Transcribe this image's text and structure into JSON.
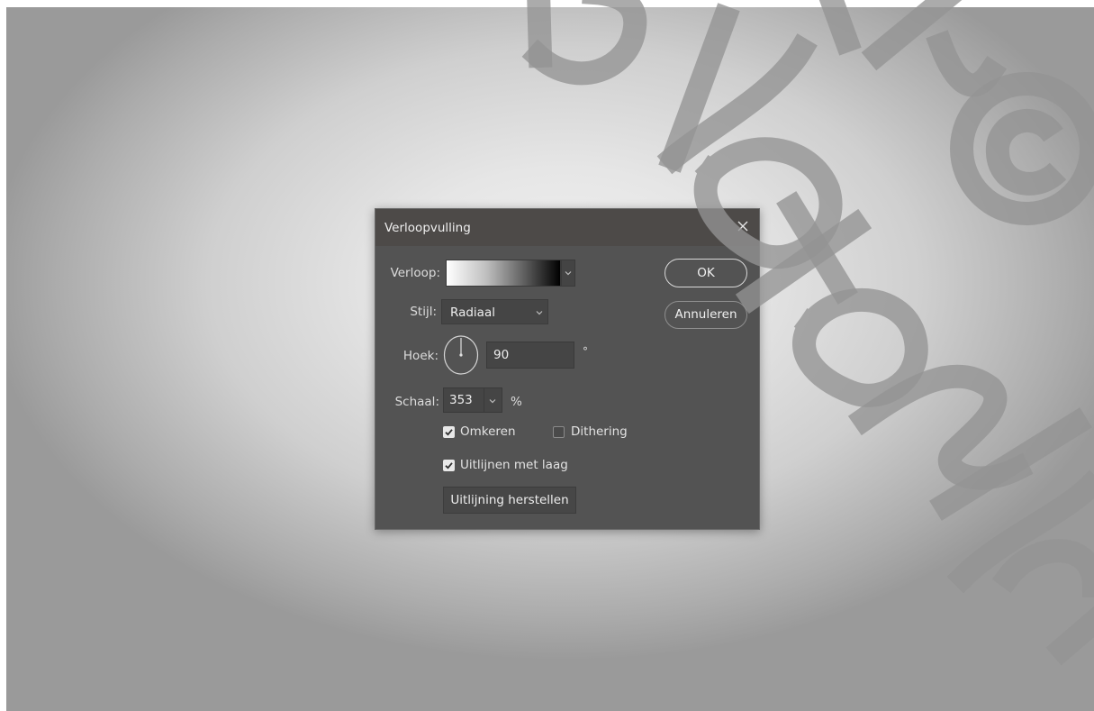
{
  "dialog": {
    "title": "Verloopvulling",
    "close_icon": "close-icon",
    "gradient": {
      "label": "Verloop:",
      "colors": [
        "#ffffff",
        "#000000"
      ]
    },
    "style": {
      "label": "Stijl:",
      "value": "Radiaal"
    },
    "angle": {
      "label": "Hoek:",
      "value": "90",
      "unit": "°"
    },
    "scale": {
      "label": "Schaal:",
      "value": "353",
      "unit": "%"
    },
    "options": {
      "reverse": {
        "label": "Omkeren",
        "checked": true
      },
      "dither": {
        "label": "Dithering",
        "checked": false
      },
      "align": {
        "label": "Uitlijnen met laag",
        "checked": true
      }
    },
    "buttons": {
      "reset_alignment": "Uitlijning herstellen",
      "ok": "OK",
      "cancel": "Annuleren"
    }
  },
  "colors": {
    "dialog_bg": "#535353",
    "titlebar_bg": "#4d4a48",
    "field_bg": "#454545",
    "text": "#e2e2e2"
  }
}
